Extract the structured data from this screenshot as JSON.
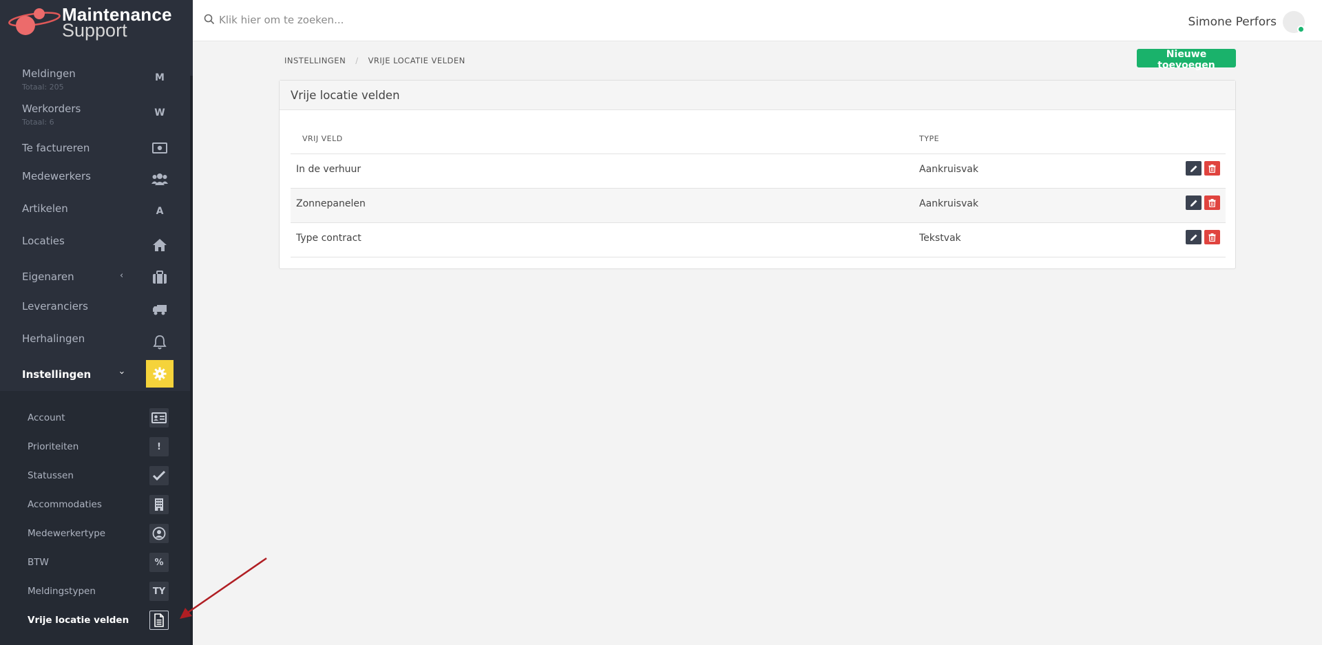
{
  "app": {
    "logo_line1": "Maintenance",
    "logo_line2": "Support"
  },
  "sidebar": {
    "items": [
      {
        "label": "Meldingen",
        "sub": "Totaal: 205",
        "icon": "M"
      },
      {
        "label": "Werkorders",
        "sub": "Totaal: 6",
        "icon": "W"
      },
      {
        "label": "Te factureren",
        "icon": "money-icon"
      },
      {
        "label": "Medewerkers",
        "icon": "users-icon"
      },
      {
        "label": "Artikelen",
        "icon": "A"
      },
      {
        "label": "Locaties",
        "icon": "home-icon"
      },
      {
        "label": "Eigenaren",
        "icon": "briefcase-icon",
        "chevron": "‹"
      },
      {
        "label": "Leveranciers",
        "icon": "truck-icon"
      },
      {
        "label": "Herhalingen",
        "icon": "bell-icon"
      },
      {
        "label": "Instellingen",
        "icon": "gear-icon",
        "chevron": "›",
        "active": true
      }
    ],
    "submenu": [
      {
        "label": "Account",
        "icon": "id-card-icon"
      },
      {
        "label": "Prioriteiten",
        "icon": "!"
      },
      {
        "label": "Statussen",
        "icon": "check-icon"
      },
      {
        "label": "Accommodaties",
        "icon": "building-icon"
      },
      {
        "label": "Medewerkertype",
        "icon": "user-circle-icon"
      },
      {
        "label": "BTW",
        "icon": "%"
      },
      {
        "label": "Meldingstypen",
        "icon": "TY"
      },
      {
        "label": "Vrije locatie velden",
        "icon": "document-icon",
        "active": true
      }
    ]
  },
  "topbar": {
    "search_placeholder": "Klik hier om te zoeken...",
    "user_name": "Simone Perfors",
    "status_color": "#1ab56f"
  },
  "breadcrumb": [
    "INSTELLINGEN",
    "VRIJE LOCATIE VELDEN"
  ],
  "actions": {
    "new_label": "Nieuwe toevoegen"
  },
  "panel": {
    "title": "Vrije locatie velden",
    "columns": [
      "VRIJ VELD",
      "TYPE"
    ],
    "rows": [
      {
        "name": "In de verhuur",
        "type": "Aankruisvak"
      },
      {
        "name": "Zonnepanelen",
        "type": "Aankruisvak"
      },
      {
        "name": "Type contract",
        "type": "Tekstvak"
      }
    ]
  },
  "colors": {
    "sidebar_bg": "#2b303b",
    "accent_yellow": "#f5d33b",
    "primary_green": "#1ab26b",
    "danger_red": "#e0443f",
    "edit_dark": "#3b4250"
  }
}
